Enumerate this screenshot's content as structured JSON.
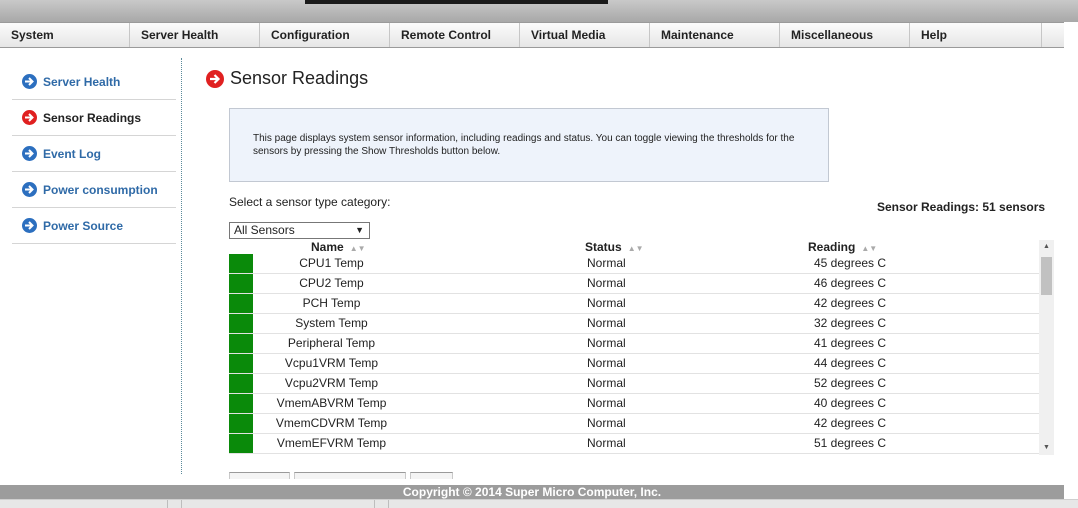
{
  "menu": {
    "items": [
      "System",
      "Server Health",
      "Configuration",
      "Remote Control",
      "Virtual Media",
      "Maintenance",
      "Miscellaneous",
      "Help"
    ]
  },
  "sidebar": {
    "items": [
      {
        "label": "Server Health",
        "active": false
      },
      {
        "label": "Sensor Readings",
        "active": true
      },
      {
        "label": "Event Log",
        "active": false
      },
      {
        "label": "Power consumption",
        "active": false
      },
      {
        "label": "Power Source",
        "active": false
      }
    ]
  },
  "page": {
    "title": "Sensor Readings",
    "info_text": "This page displays system sensor information, including readings and status. You can toggle viewing the thresholds for the sensors by pressing the Show Thresholds button below.",
    "category_label": "Select a sensor type category:",
    "count_label": "Sensor Readings: 51 sensors",
    "select_value": "All Sensors"
  },
  "table": {
    "headers": {
      "name": "Name",
      "status": "Status",
      "reading": "Reading"
    },
    "rows": [
      {
        "name": "CPU1 Temp",
        "status": "Normal",
        "reading": "45 degrees C"
      },
      {
        "name": "CPU2 Temp",
        "status": "Normal",
        "reading": "46 degrees C"
      },
      {
        "name": "PCH Temp",
        "status": "Normal",
        "reading": "42 degrees C"
      },
      {
        "name": "System Temp",
        "status": "Normal",
        "reading": "32 degrees C"
      },
      {
        "name": "Peripheral Temp",
        "status": "Normal",
        "reading": "41 degrees C"
      },
      {
        "name": "Vcpu1VRM Temp",
        "status": "Normal",
        "reading": "44 degrees C"
      },
      {
        "name": "Vcpu2VRM Temp",
        "status": "Normal",
        "reading": "52 degrees C"
      },
      {
        "name": "VmemABVRM Temp",
        "status": "Normal",
        "reading": "40 degrees C"
      },
      {
        "name": "VmemCDVRM Temp",
        "status": "Normal",
        "reading": "42 degrees C"
      },
      {
        "name": "VmemEFVRM Temp",
        "status": "Normal",
        "reading": "51 degrees C"
      }
    ]
  },
  "footer": {
    "copyright": "Copyright © 2014 Super Micro Computer, Inc."
  },
  "colors": {
    "status_ok": "#0a8a0a",
    "active_arrow": "#e02020",
    "nav_arrow": "#2c6fbf",
    "link": "#2f6aa7"
  }
}
